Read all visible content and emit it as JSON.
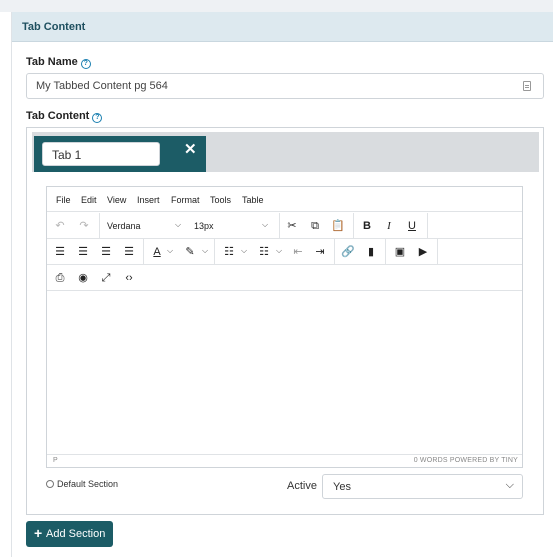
{
  "panel": {
    "title": "Tab Content"
  },
  "tab_name": {
    "label": "Tab Name",
    "value": "My Tabbed Content pg 564"
  },
  "tab_content": {
    "label": "Tab Content"
  },
  "tabs": [
    {
      "value": "Tab 1",
      "close": "✕"
    }
  ],
  "editor": {
    "menu": [
      "File",
      "Edit",
      "View",
      "Insert",
      "Format",
      "Tools",
      "Table"
    ],
    "font_family": "Verdana",
    "font_size": "13px",
    "status_path": "P",
    "status_right": "0 WORDS  POWERED BY TINY"
  },
  "section": {
    "default_label": "Default Section",
    "active_label": "Active",
    "active_value": "Yes"
  },
  "add_section": {
    "label": "Add Section"
  },
  "colors": {
    "accent": "#1c5c66",
    "header_bg": "#dde9ef",
    "header_text": "#1e4f5f"
  }
}
